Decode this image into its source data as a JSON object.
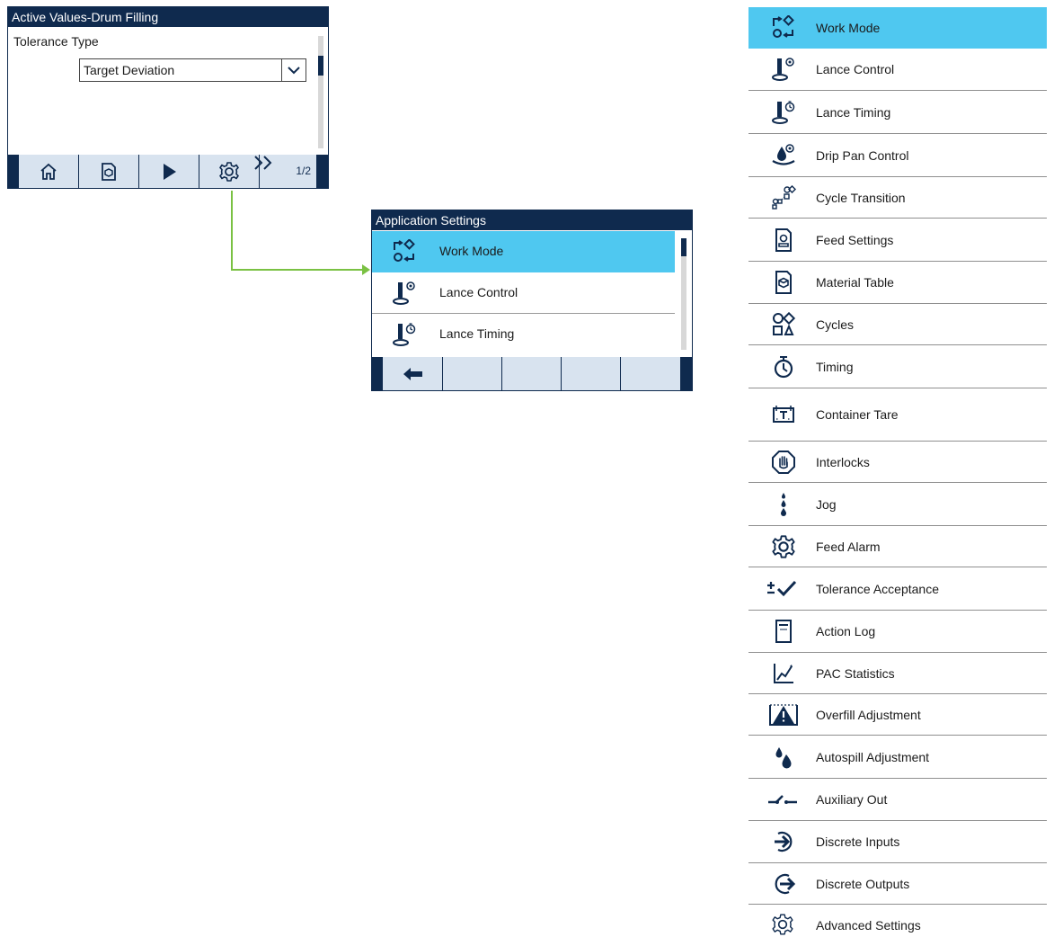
{
  "panel_active": {
    "title": "Active Values-Drum Filling",
    "field_label": "Tolerance Type",
    "dropdown_value": "Target Deviation",
    "page_indicator": "1/2",
    "softkeys": [
      "home-icon",
      "material-icon",
      "play-icon",
      "gear-icon",
      "next-page-icon"
    ]
  },
  "panel_app": {
    "title": "Application Settings",
    "items": [
      {
        "label": "Work Mode",
        "icon": "work-mode-icon",
        "selected": true
      },
      {
        "label": "Lance Control",
        "icon": "lance-control-icon"
      },
      {
        "label": "Lance Timing",
        "icon": "lance-timing-icon"
      }
    ],
    "softkeys": [
      "back-arrow-icon",
      "",
      "",
      "",
      ""
    ]
  },
  "menu": {
    "items": [
      {
        "label": "Work Mode",
        "icon": "work-mode-icon",
        "selected": true
      },
      {
        "label": "Lance Control",
        "icon": "lance-control-icon"
      },
      {
        "label": "Lance Timing",
        "icon": "lance-timing-icon"
      },
      {
        "label": "Drip Pan Control",
        "icon": "drip-pan-icon"
      },
      {
        "label": "Cycle Transition",
        "icon": "cycle-transition-icon"
      },
      {
        "label": "Feed Settings",
        "icon": "feed-settings-icon"
      },
      {
        "label": "Material Table",
        "icon": "material-table-icon"
      },
      {
        "label": "Cycles",
        "icon": "cycles-icon"
      },
      {
        "label": "Timing",
        "icon": "timer-icon"
      },
      {
        "label": "Container Tare",
        "icon": "container-tare-icon"
      },
      {
        "label": "Interlocks",
        "icon": "interlock-hand-icon"
      },
      {
        "label": "Jog",
        "icon": "jog-icon"
      },
      {
        "label": "Feed Alarm",
        "icon": "gear-icon"
      },
      {
        "label": "Tolerance Acceptance",
        "icon": "tolerance-check-icon"
      },
      {
        "label": "Action Log",
        "icon": "action-log-icon"
      },
      {
        "label": "PAC Statistics",
        "icon": "statistics-icon"
      },
      {
        "label": "Overfill Adjustment",
        "icon": "overfill-warning-icon"
      },
      {
        "label": "Autospill Adjustment",
        "icon": "drops-icon"
      },
      {
        "label": "Auxiliary Out",
        "icon": "switch-icon"
      },
      {
        "label": "Discrete Inputs",
        "icon": "input-arrow-icon"
      },
      {
        "label": "Discrete Outputs",
        "icon": "output-arrow-icon"
      },
      {
        "label": "Advanced Settings",
        "icon": "gear-icon"
      }
    ]
  },
  "colors": {
    "navy": "#0f2a4e",
    "selected": "#4fc8f0",
    "softkey": "#d8e3ef",
    "connector": "#7ac143"
  }
}
